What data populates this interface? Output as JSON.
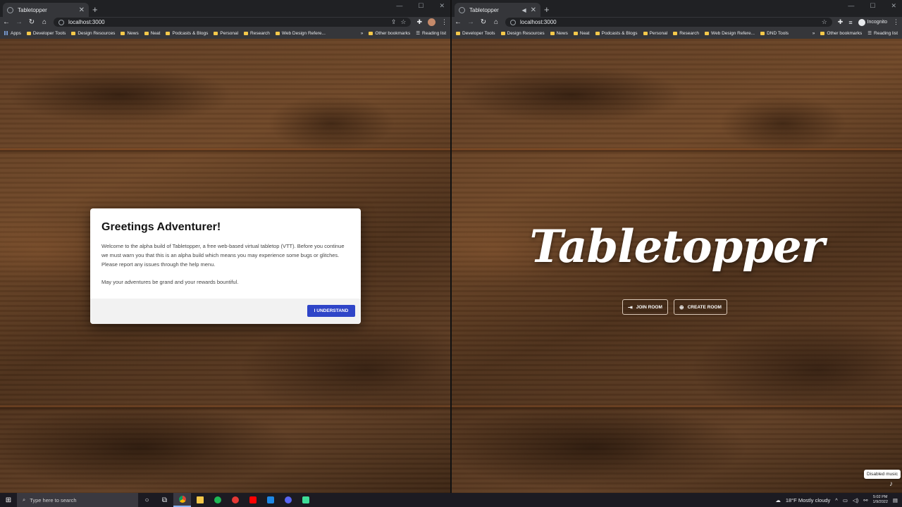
{
  "left_window": {
    "tab_title": "Tabletopper",
    "url": "localhost:3000",
    "bookmarks": [
      "Apps",
      "Developer Tools",
      "Design Resources",
      "News",
      "Neat",
      "Podcasts & Blogs",
      "Personal",
      "Research",
      "Web Design Refere..."
    ],
    "other_bookmarks": "Other bookmarks",
    "reading_list": "Reading list",
    "modal": {
      "title": "Greetings Adventurer!",
      "paragraph1": "Welcome to the alpha build of Tabletopper, a free web-based virtual tabletop (VTT). Before you continue we must warn you that this is an alpha build which means you may experience some bugs or glitches. Please report any issues through the help menu.",
      "paragraph2": "May your adventures be grand and your rewards bountiful.",
      "button": "I UNDERSTAND"
    }
  },
  "right_window": {
    "tab_title": "Tabletopper",
    "url": "localhost:3000",
    "incognito_label": "Incognito",
    "bookmarks": [
      "Developer Tools",
      "Design Resources",
      "News",
      "Neat",
      "Podcasts & Blogs",
      "Personal",
      "Research",
      "Web Design Refere...",
      "DND Tools"
    ],
    "other_bookmarks": "Other bookmarks",
    "reading_list": "Reading list",
    "logo": "Tabletopper",
    "join_button": "JOIN ROOM",
    "create_button": "CREATE ROOM",
    "tooltip": "Disabled music"
  },
  "taskbar": {
    "search_placeholder": "Type here to search",
    "weather": "18°F  Mostly cloudy",
    "time": "5:02 PM",
    "date": "1/9/2022"
  },
  "colors": {
    "primary_button": "#2f45c8",
    "modal_footer": "#f2f2f2"
  }
}
